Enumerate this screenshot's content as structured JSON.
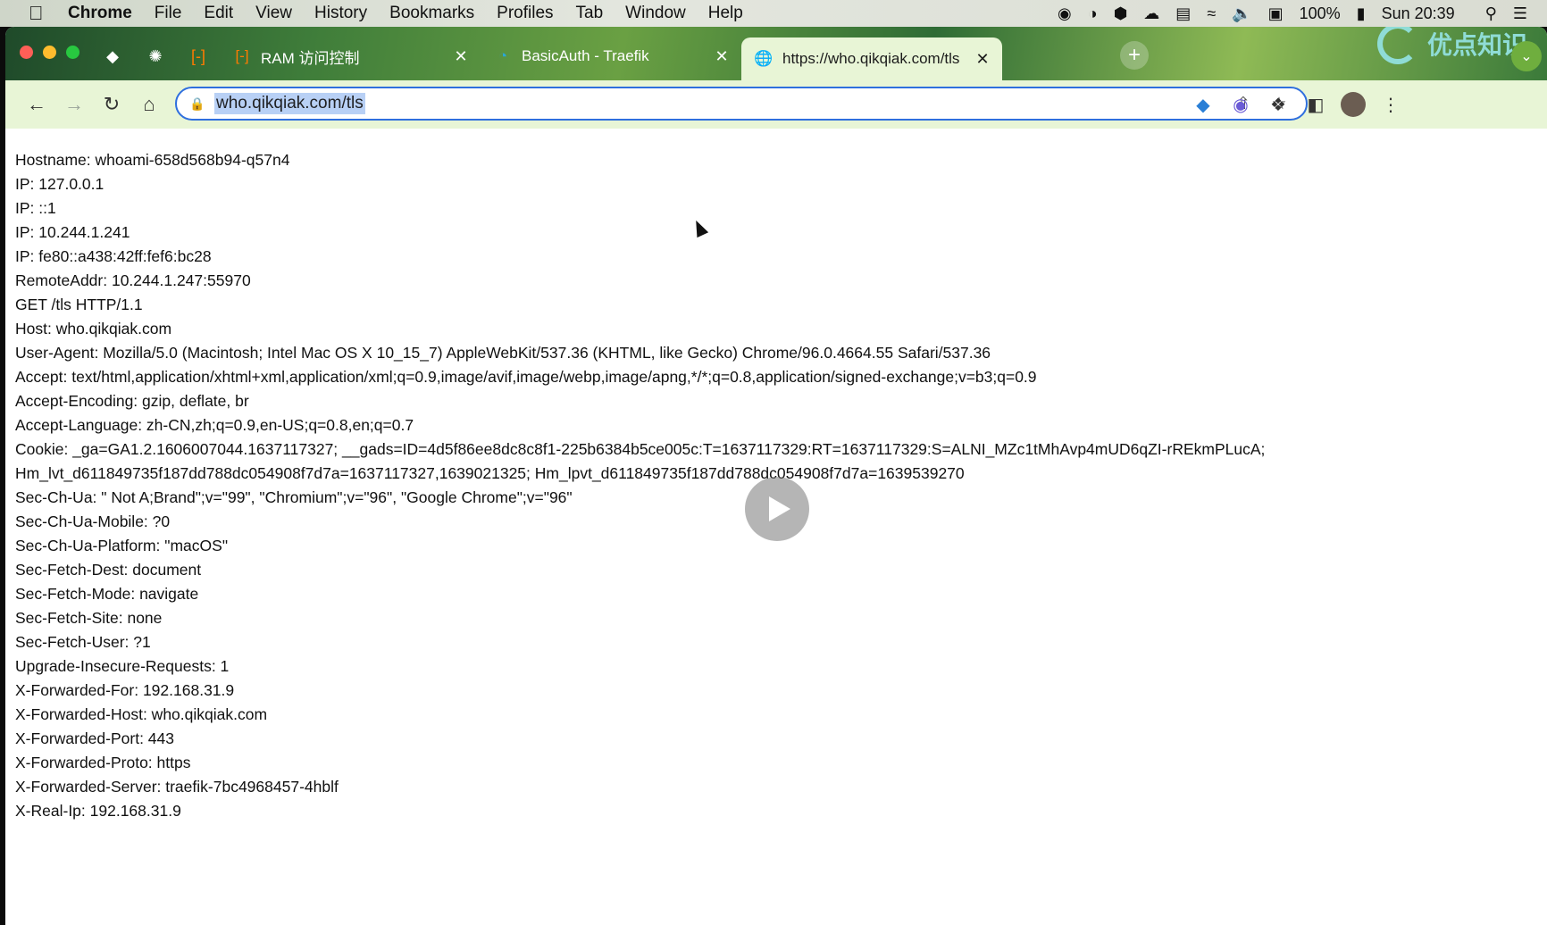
{
  "menubar": {
    "app_name": "Chrome",
    "items": [
      "File",
      "Edit",
      "View",
      "History",
      "Bookmarks",
      "Profiles",
      "Tab",
      "Window",
      "Help"
    ],
    "battery": "100%",
    "clock": "Sun 20:39"
  },
  "watermark": "优点知识",
  "tabs": [
    {
      "title": "RAM 访问控制"
    },
    {
      "title": "BasicAuth - Traefik"
    },
    {
      "title": "https://who.qikqiak.com/tls"
    }
  ],
  "toolbar": {
    "url": "who.qikqiak.com/tls"
  },
  "page": {
    "lines": [
      "Hostname: whoami-658d568b94-q57n4",
      "IP: 127.0.0.1",
      "IP: ::1",
      "IP: 10.244.1.241",
      "IP: fe80::a438:42ff:fef6:bc28",
      "RemoteAddr: 10.244.1.247:55970",
      "GET /tls HTTP/1.1",
      "Host: who.qikqiak.com",
      "User-Agent: Mozilla/5.0 (Macintosh; Intel Mac OS X 10_15_7) AppleWebKit/537.36 (KHTML, like Gecko) Chrome/96.0.4664.55 Safari/537.36",
      "Accept: text/html,application/xhtml+xml,application/xml;q=0.9,image/avif,image/webp,image/apng,*/*;q=0.8,application/signed-exchange;v=b3;q=0.9",
      "Accept-Encoding: gzip, deflate, br",
      "Accept-Language: zh-CN,zh;q=0.9,en-US;q=0.8,en;q=0.7",
      "Cookie: _ga=GA1.2.1606007044.1637117327; __gads=ID=4d5f86ee8dc8c8f1-225b6384b5ce005c:T=1637117329:RT=1637117329:S=ALNI_MZc1tMhAvp4mUD6qZI-rREkmPLucA;",
      "Hm_lvt_d611849735f187dd788dc054908f7d7a=1637117327,1639021325; Hm_lpvt_d611849735f187dd788dc054908f7d7a=1639539270",
      "Sec-Ch-Ua: \" Not A;Brand\";v=\"99\", \"Chromium\";v=\"96\", \"Google Chrome\";v=\"96\"",
      "Sec-Ch-Ua-Mobile: ?0",
      "Sec-Ch-Ua-Platform: \"macOS\"",
      "Sec-Fetch-Dest: document",
      "Sec-Fetch-Mode: navigate",
      "Sec-Fetch-Site: none",
      "Sec-Fetch-User: ?1",
      "Upgrade-Insecure-Requests: 1",
      "X-Forwarded-For: 192.168.31.9",
      "X-Forwarded-Host: who.qikqiak.com",
      "X-Forwarded-Port: 443",
      "X-Forwarded-Proto: https",
      "X-Forwarded-Server: traefik-7bc4968457-4hblf",
      "X-Real-Ip: 192.168.31.9"
    ]
  }
}
